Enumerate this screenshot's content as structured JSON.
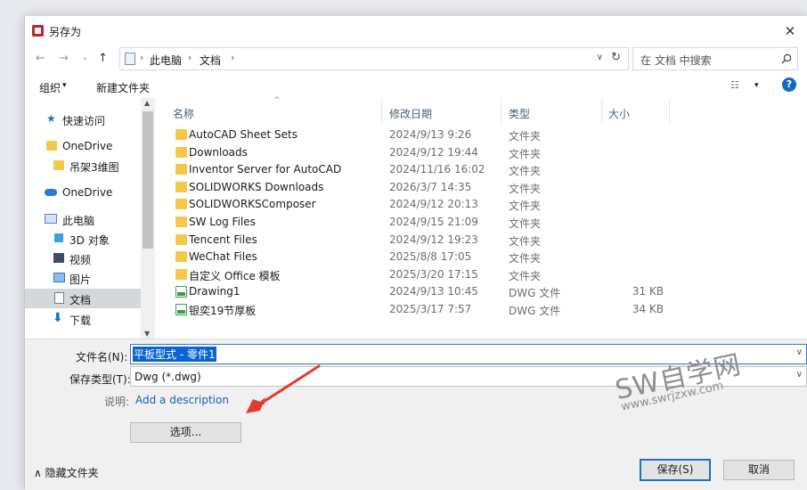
{
  "window": {
    "title": "另存为",
    "close_glyph": "✕"
  },
  "nav_buttons": {
    "back": "←",
    "forward": "→",
    "recent": "⌄",
    "up": "↑"
  },
  "address": {
    "crumbs": [
      "此电脑",
      "文档"
    ],
    "separator": "›",
    "dropdown_glyph": "∨",
    "refresh_glyph": "↻"
  },
  "search": {
    "placeholder": "在 文档 中搜索",
    "icon": "search-icon"
  },
  "toolbar": {
    "organize_label": "组织",
    "organize_caret": "▾",
    "new_folder_label": "新建文件夹",
    "view_glyph": "☷",
    "help_glyph": "?"
  },
  "sidebar": {
    "items": [
      {
        "label": "快速访问",
        "icon": "star-icon"
      },
      {
        "label": "OneDrive",
        "icon": "folder-icon"
      },
      {
        "label": "吊架3维图",
        "icon": "folder-icon"
      },
      {
        "label": "OneDrive",
        "icon": "cloud-icon"
      },
      {
        "label": "此电脑",
        "icon": "computer-icon"
      },
      {
        "label": "3D 对象",
        "icon": "cube-icon"
      },
      {
        "label": "视频",
        "icon": "video-icon"
      },
      {
        "label": "图片",
        "icon": "picture-icon"
      },
      {
        "label": "文档",
        "icon": "document-icon"
      },
      {
        "label": "下载",
        "icon": "download-icon"
      }
    ],
    "selected": "文档"
  },
  "file_list": {
    "columns": [
      "名称",
      "修改日期",
      "类型",
      "大小"
    ],
    "rows": [
      {
        "name": "AutoCAD Sheet Sets",
        "date": "2024/9/13 9:26",
        "type": "文件夹",
        "size": ""
      },
      {
        "name": "Downloads",
        "date": "2024/9/12 19:44",
        "type": "文件夹",
        "size": ""
      },
      {
        "name": "Inventor Server for AutoCAD",
        "date": "2024/11/16 16:02",
        "type": "文件夹",
        "size": ""
      },
      {
        "name": "SOLIDWORKS Downloads",
        "date": "2026/3/7 14:35",
        "type": "文件夹",
        "size": ""
      },
      {
        "name": "SOLIDWORKSComposer",
        "date": "2024/9/12 20:13",
        "type": "文件夹",
        "size": ""
      },
      {
        "name": "SW Log Files",
        "date": "2024/9/15 21:09",
        "type": "文件夹",
        "size": ""
      },
      {
        "name": "Tencent Files",
        "date": "2024/9/12 19:23",
        "type": "文件夹",
        "size": ""
      },
      {
        "name": "WeChat Files",
        "date": "2025/8/8 17:05",
        "type": "文件夹",
        "size": ""
      },
      {
        "name": "自定义 Office 模板",
        "date": "2025/3/20 17:15",
        "type": "文件夹",
        "size": ""
      },
      {
        "name": "Drawing1",
        "date": "2024/9/13 10:45",
        "type": "DWG 文件",
        "size": "31 KB"
      },
      {
        "name": "银奕19节厚板",
        "date": "2025/3/17 7:57",
        "type": "DWG 文件",
        "size": "34 KB"
      }
    ]
  },
  "form": {
    "filename_label": "文件名(N):",
    "filename_value": "平板型式 - 零件1",
    "filetype_label": "保存类型(T):",
    "filetype_value": "Dwg (*.dwg)",
    "description_label": "说明:",
    "description_link": "Add a description",
    "options_button": "选项..."
  },
  "footer": {
    "hide_folders_label": "隐藏文件夹",
    "hide_folders_glyph": "∧",
    "save_button": "保存(S)",
    "cancel_button": "取消"
  },
  "watermark": {
    "brand": "SW自学网",
    "url": "www.swrjzxw.com"
  },
  "colors": {
    "accent": "#1a6fd1",
    "selection": "#0a64d6",
    "arrow": "#e8392e",
    "folder": "#f4c84c"
  }
}
